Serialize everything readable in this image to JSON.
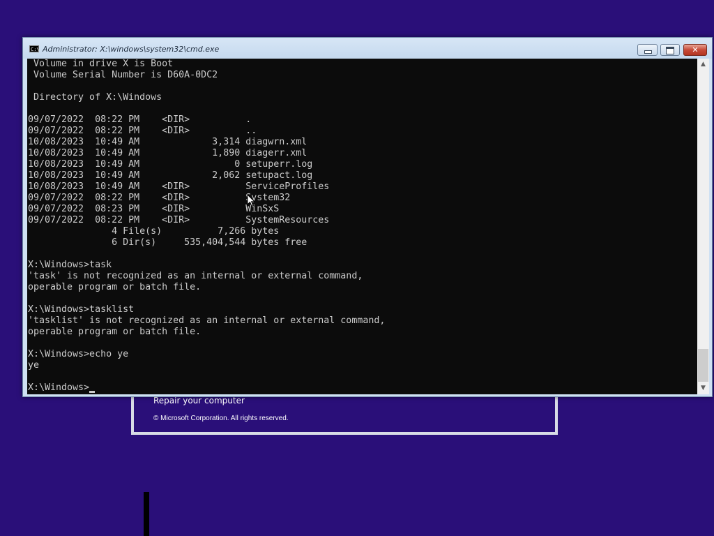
{
  "setup": {
    "repair_link": "Repair your computer",
    "copyright": "© Microsoft Corporation. All rights reserved."
  },
  "window": {
    "title": "Administrator: X:\\windows\\system32\\cmd.exe",
    "icon_label": "C:\\",
    "buttons": [
      "minimize-icon",
      "maximize-icon",
      "close-icon"
    ]
  },
  "console": {
    "lines": [
      " Volume in drive X is Boot",
      " Volume Serial Number is D60A-0DC2",
      "",
      " Directory of X:\\Windows",
      "",
      "09/07/2022  08:22 PM    <DIR>          .",
      "09/07/2022  08:22 PM    <DIR>          ..",
      "10/08/2023  10:49 AM             3,314 diagwrn.xml",
      "10/08/2023  10:49 AM             1,890 diagerr.xml",
      "10/08/2023  10:49 AM                 0 setuperr.log",
      "10/08/2023  10:49 AM             2,062 setupact.log",
      "10/08/2023  10:49 AM    <DIR>          ServiceProfiles",
      "09/07/2022  08:22 PM    <DIR>          System32",
      "09/07/2022  08:23 PM    <DIR>          WinSxS",
      "09/07/2022  08:22 PM    <DIR>          SystemResources",
      "               4 File(s)          7,266 bytes",
      "               6 Dir(s)     535,404,544 bytes free",
      "",
      "X:\\Windows>task",
      "'task' is not recognized as an internal or external command,",
      "operable program or batch file.",
      "",
      "X:\\Windows>tasklist",
      "'tasklist' is not recognized as an internal or external command,",
      "operable program or batch file.",
      "",
      "X:\\Windows>echo ye",
      "ye",
      ""
    ],
    "prompt": "X:\\Windows>"
  },
  "colors": {
    "desktop": "#2a0f79",
    "console_bg": "#0c0c0c",
    "console_fg": "#cccccc"
  }
}
